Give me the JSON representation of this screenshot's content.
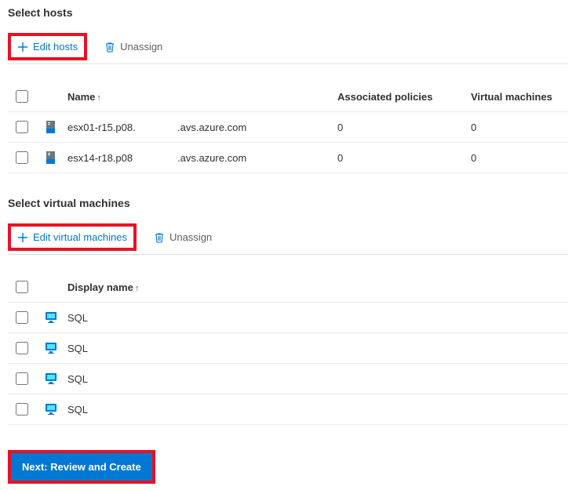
{
  "hosts_section": {
    "title": "Select hosts",
    "edit_label": "Edit hosts",
    "unassign_label": "Unassign",
    "columns": {
      "name": "Name",
      "policies": "Associated policies",
      "vms": "Virtual machines"
    },
    "rows": [
      {
        "name": "esx01-r15.p08.",
        "domain": ".avs.azure.com",
        "policies": "0",
        "vms": "0"
      },
      {
        "name": "esx14-r18.p08",
        "domain": ".avs.azure.com",
        "policies": "0",
        "vms": "0"
      }
    ]
  },
  "vms_section": {
    "title": "Select virtual machines",
    "edit_label": "Edit virtual machines",
    "unassign_label": "Unassign",
    "columns": {
      "display_name": "Display name"
    },
    "rows": [
      {
        "name": "SQL"
      },
      {
        "name": "SQL"
      },
      {
        "name": "SQL"
      },
      {
        "name": "SQL"
      }
    ]
  },
  "footer": {
    "next_label": "Next: Review and Create"
  }
}
